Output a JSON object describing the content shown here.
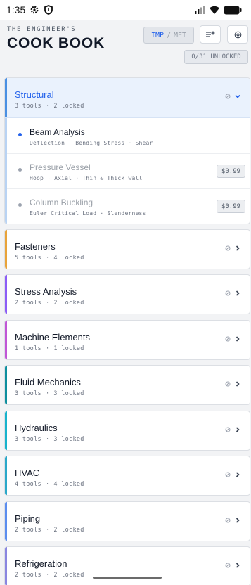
{
  "status": {
    "time": "1:35",
    "left_icons": [
      "gear-icon",
      "shield-icon"
    ],
    "right_icons": [
      "signal-icon",
      "wifi-icon",
      "battery-icon"
    ]
  },
  "header": {
    "eyebrow": "THE ENGINEER'S",
    "title": "COOK BOOK",
    "unit_toggle": {
      "imperial": "IMP",
      "separator": "/",
      "metric": "MET",
      "selected": "IMP"
    },
    "sort_button_icon": "sort-list-icon",
    "settings_button_icon": "settings-icon",
    "unlocked_badge": "0/31 UNLOCKED"
  },
  "colors": {
    "accent": "#2563eb",
    "structural": "#4a90e2",
    "fasteners": "#e8a33a",
    "stress_analysis": "#8b5cf6",
    "machine_elements": "#c056d6",
    "fluid_mechanics": "#0e8f9e",
    "hydraulics": "#17b3cc",
    "hvac": "#2aa8c9",
    "piping": "#5b8def",
    "refrigeration": "#8a86e0"
  },
  "categories": [
    {
      "name": "Structural",
      "tools_count": "3 tools",
      "locked_count": "2 locked",
      "expanded": true,
      "tools": [
        {
          "name": "Beam Analysis",
          "description": "Deflection · Bending Stress · Shear",
          "price": "",
          "locked": false
        },
        {
          "name": "Pressure Vessel",
          "description": "Hoop · Axial · Thin & Thick wall",
          "price": "$0.99",
          "locked": true
        },
        {
          "name": "Column Buckling",
          "description": "Euler Critical Load · Slenderness",
          "price": "$0.99",
          "locked": true
        }
      ]
    },
    {
      "name": "Fasteners",
      "tools_count": "5 tools",
      "locked_count": "4 locked",
      "expanded": false
    },
    {
      "name": "Stress Analysis",
      "tools_count": "2 tools",
      "locked_count": "2 locked",
      "expanded": false
    },
    {
      "name": "Machine Elements",
      "tools_count": "1 tools",
      "locked_count": "1 locked",
      "expanded": false
    },
    {
      "name": "Fluid Mechanics",
      "tools_count": "3 tools",
      "locked_count": "3 locked",
      "expanded": false
    },
    {
      "name": "Hydraulics",
      "tools_count": "3 tools",
      "locked_count": "3 locked",
      "expanded": false
    },
    {
      "name": "HVAC",
      "tools_count": "4 tools",
      "locked_count": "4 locked",
      "expanded": false
    },
    {
      "name": "Piping",
      "tools_count": "2 tools",
      "locked_count": "2 locked",
      "expanded": false
    },
    {
      "name": "Refrigeration",
      "tools_count": "2 tools",
      "locked_count": "2 locked",
      "expanded": false
    }
  ],
  "separator": "·"
}
